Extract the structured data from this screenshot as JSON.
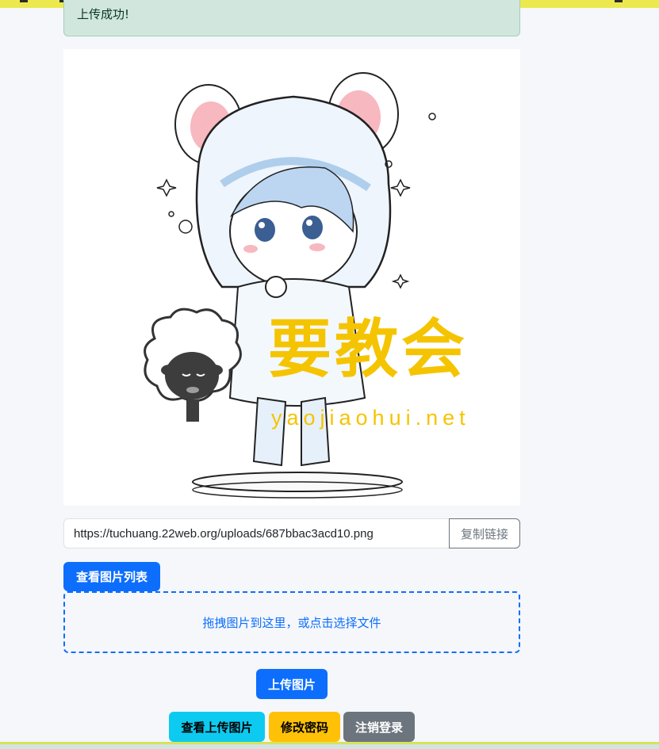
{
  "alert": {
    "message": "上传成功!"
  },
  "preview": {
    "watermark_text": "要教会",
    "watermark_url": "yaojiaohui.net",
    "watermark_color": "#f5c400"
  },
  "url_field": {
    "value": "https://tuchuang.22web.org/uploads/687bbac3acd10.png"
  },
  "copy_button": {
    "label": "复制链接"
  },
  "list_button": {
    "label": "查看图片列表"
  },
  "dropzone": {
    "text": "拖拽图片到这里，或点击选择文件"
  },
  "upload_button": {
    "label": "上传图片"
  },
  "footer_buttons": {
    "view_uploaded": "查看上传图片",
    "change_password": "修改密码",
    "logout": "注销登录"
  },
  "colors": {
    "primary": "#0d6efd",
    "info": "#0dcaf0",
    "warning": "#ffc107",
    "secondary": "#6c757d",
    "success_bg": "#d1e7dd"
  }
}
